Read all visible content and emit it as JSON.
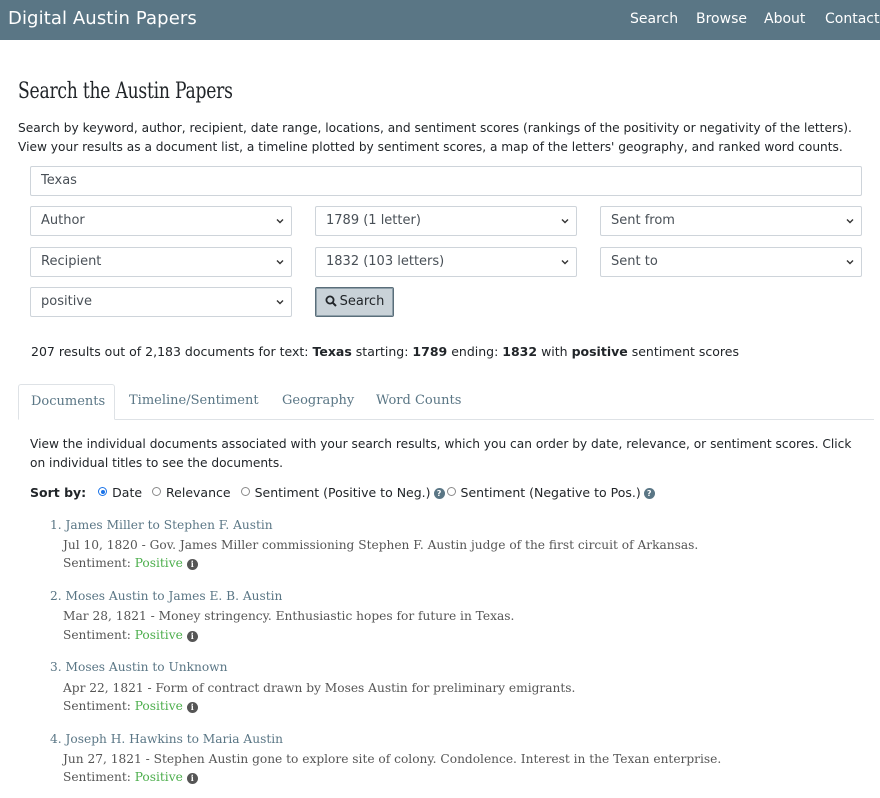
{
  "header": {
    "brand": "Digital Austin Papers",
    "nav": [
      "Search",
      "Browse",
      "About",
      "Contact"
    ]
  },
  "page": {
    "title": "Search the Austin Papers",
    "intro_line1": "Search by keyword, author, recipient, date range, locations, and sentiment scores (rankings of the positivity or negativity of the letters).",
    "intro_line2": "View your results as a document list, a timeline plotted by sentiment scores, a map of the letters' geography, and ranked word counts."
  },
  "form": {
    "text_value": "Texas",
    "author": "Author",
    "start_date": "1789 (1 letter)",
    "sent_from": "Sent from",
    "recipient": "Recipient",
    "end_date": "1832 (103 letters)",
    "sent_to": "Sent to",
    "sentiment": "positive",
    "search_label": "Search"
  },
  "summary": {
    "prefix": "207 results out of 2,183 documents for text:",
    "text": "Texas",
    "starting_label": "starting:",
    "start": "1789",
    "ending_label": "ending:",
    "end": "1832",
    "with_label": "with",
    "sentiment": "positive",
    "suffix": "sentiment scores"
  },
  "tabs": [
    "Documents",
    "Timeline/Sentiment",
    "Geography",
    "Word Counts"
  ],
  "documents": {
    "desc_line1": "View the individual documents associated with your search results, which you can order by date, relevance, or sentiment scores. Click",
    "desc_line2": "on individual titles to see the documents.",
    "sort_label": "Sort by:",
    "sort_options": [
      "Date",
      "Relevance",
      "Sentiment (Positive to Neg.)",
      "Sentiment (Negative to Pos.)"
    ],
    "selected_sort": "Date"
  },
  "results": [
    {
      "num": "1.",
      "title": "James Miller to Stephen F. Austin",
      "summary": "Jul 10, 1820 - Gov. James Miller commissioning Stephen F. Austin judge of the first circuit of Arkansas.",
      "sentiment_label": "Sentiment:",
      "sentiment": "Positive"
    },
    {
      "num": "2.",
      "title": "Moses Austin to James E. B. Austin",
      "summary": "Mar 28, 1821 - Money stringency. Enthusiastic hopes for future in Texas.",
      "sentiment_label": "Sentiment:",
      "sentiment": "Positive"
    },
    {
      "num": "3.",
      "title": "Moses Austin to Unknown",
      "summary": "Apr 22, 1821 - Form of contract drawn by Moses Austin for preliminary emigrants.",
      "sentiment_label": "Sentiment:",
      "sentiment": "Positive"
    },
    {
      "num": "4.",
      "title": "Joseph H. Hawkins to Maria Austin",
      "summary": "Jun 27, 1821 - Stephen Austin gone to explore site of colony. Condolence. Interest in the Texan enterprise.",
      "sentiment_label": "Sentiment:",
      "sentiment": "Positive"
    }
  ],
  "colors": {
    "navbar": "#5a7685",
    "link": "#5a7685",
    "positive": "#4cae4c"
  }
}
